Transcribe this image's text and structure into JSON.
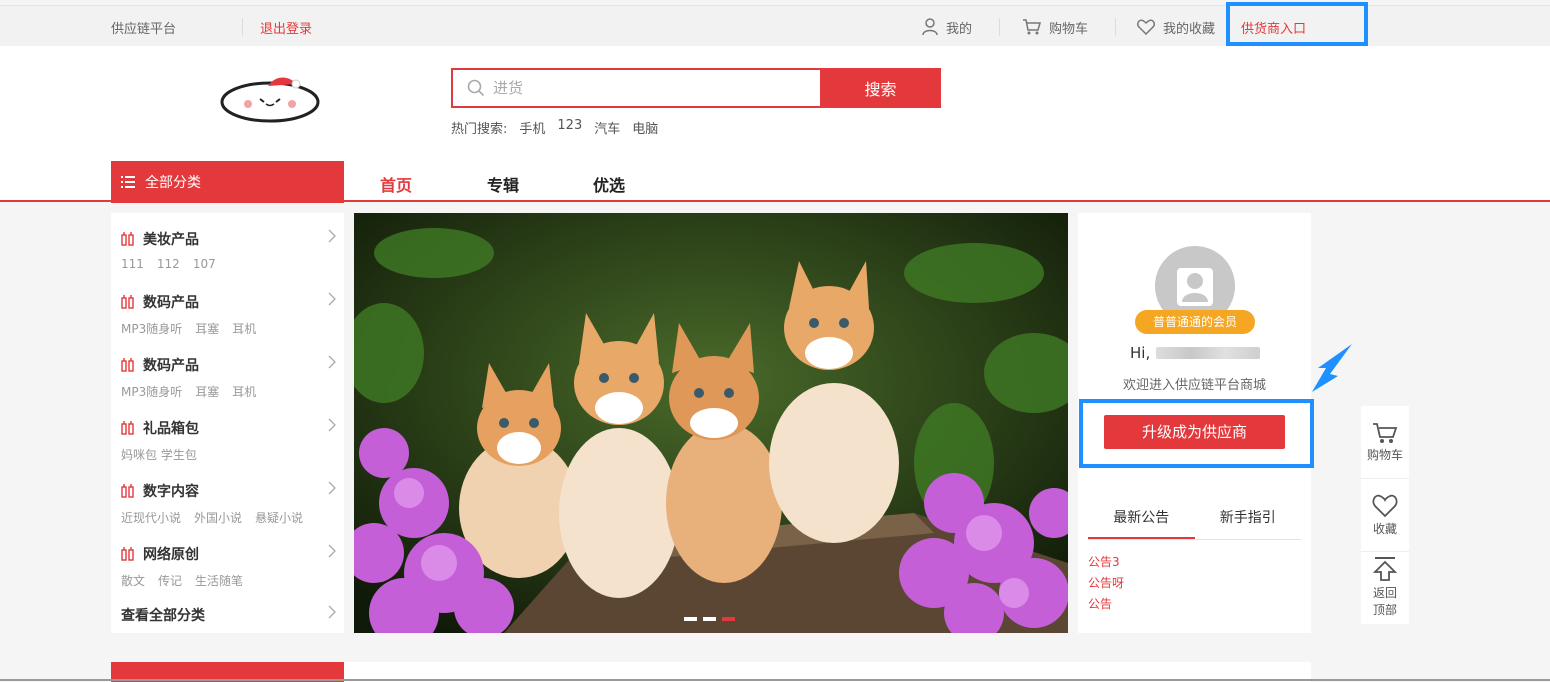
{
  "topbar": {
    "site_name": "供应链平台",
    "logout": "退出登录",
    "my": "我的",
    "cart": "购物车",
    "favorites": "我的收藏",
    "supplier_entry": "供货商入口"
  },
  "search": {
    "placeholder": "进货",
    "button": "搜索",
    "hot_label": "热门搜索:",
    "hot_terms": [
      "手机",
      "123",
      "汽车",
      "电脑"
    ]
  },
  "nav": {
    "all_categories": "全部分类",
    "links": [
      "首页",
      "专辑",
      "优选"
    ]
  },
  "categories": [
    {
      "title": "美妆产品",
      "subs": [
        "111",
        "112",
        "107"
      ]
    },
    {
      "title": "数码产品",
      "subs": [
        "MP3随身听",
        "耳塞",
        "耳机"
      ]
    },
    {
      "title": "数码产品",
      "subs": [
        "MP3随身听",
        "耳塞",
        "耳机"
      ]
    },
    {
      "title": "礼品箱包",
      "subs": [
        "妈咪包 学生包"
      ]
    },
    {
      "title": "数字内容",
      "subs": [
        "近现代小说",
        "外国小说",
        "悬疑小说"
      ]
    },
    {
      "title": "网络原创",
      "subs": [
        "散文",
        "传记",
        "生活随笔"
      ]
    }
  ],
  "all_categories_link": "查看全部分类",
  "banner": {
    "slide_count": 3,
    "active_slide": 3
  },
  "user": {
    "member_level": "普普通通的会员",
    "greeting": "Hi,",
    "welcome": "欢迎进入供应链平台商城",
    "upgrade": "升级成为供应商"
  },
  "notices": {
    "tabs": [
      "最新公告",
      "新手指引"
    ],
    "items": [
      "公告3",
      "公告呀",
      "公告"
    ]
  },
  "sidebar": {
    "cart": "购物车",
    "favorites": "收藏",
    "back_top": [
      "返回",
      "顶部"
    ]
  },
  "colors": {
    "brand_red": "#e4393c",
    "highlight_blue": "#1e90ff",
    "badge_orange": "#f5a623"
  }
}
